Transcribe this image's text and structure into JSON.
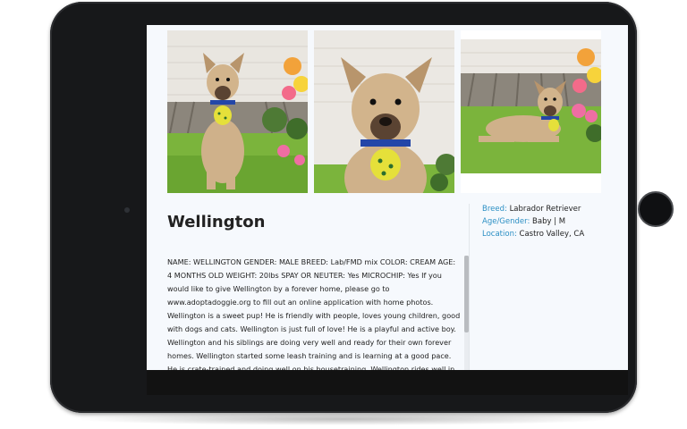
{
  "dog": {
    "name": "Wellington",
    "details": [
      {
        "label": "Breed:",
        "value": "Labrador Retriever"
      },
      {
        "label": "Age/Gender:",
        "value": "Baby | M"
      },
      {
        "label": "Location:",
        "value": "Castro Valley, CA"
      }
    ],
    "description": "NAME: WELLINGTON GENDER: MALE BREED: Lab/FMD mix COLOR: CREAM AGE: 4 MONTHS OLD WEIGHT: 20lbs SPAY OR NEUTER: Yes MICROCHIP: Yes If you would like to give Wellington by a forever home, please go to www.adoptadoggie.org to fill out an online application with home photos. Wellington is a sweet pup! He is friendly with people, loves young children, good with dogs and cats. Wellington is just full of love! He is a playful and active boy. Wellington and his siblings are doing very well and ready for their own forever homes. Wellington started some leash training and is learning at a good pace. He is crate-trained and doing well on his housetraining. Wellington rides well in the car and enjoys both a quiet home or an active life. He is"
  },
  "photos": [
    {
      "subject": "puppy sitting on grass"
    },
    {
      "subject": "puppy close-up"
    },
    {
      "subject": "puppy lying on grass"
    }
  ],
  "colors": {
    "label_accent": "#2b8fc4",
    "tablet_bezel": "#17181a",
    "screen_bg": "#f6f9fd"
  }
}
